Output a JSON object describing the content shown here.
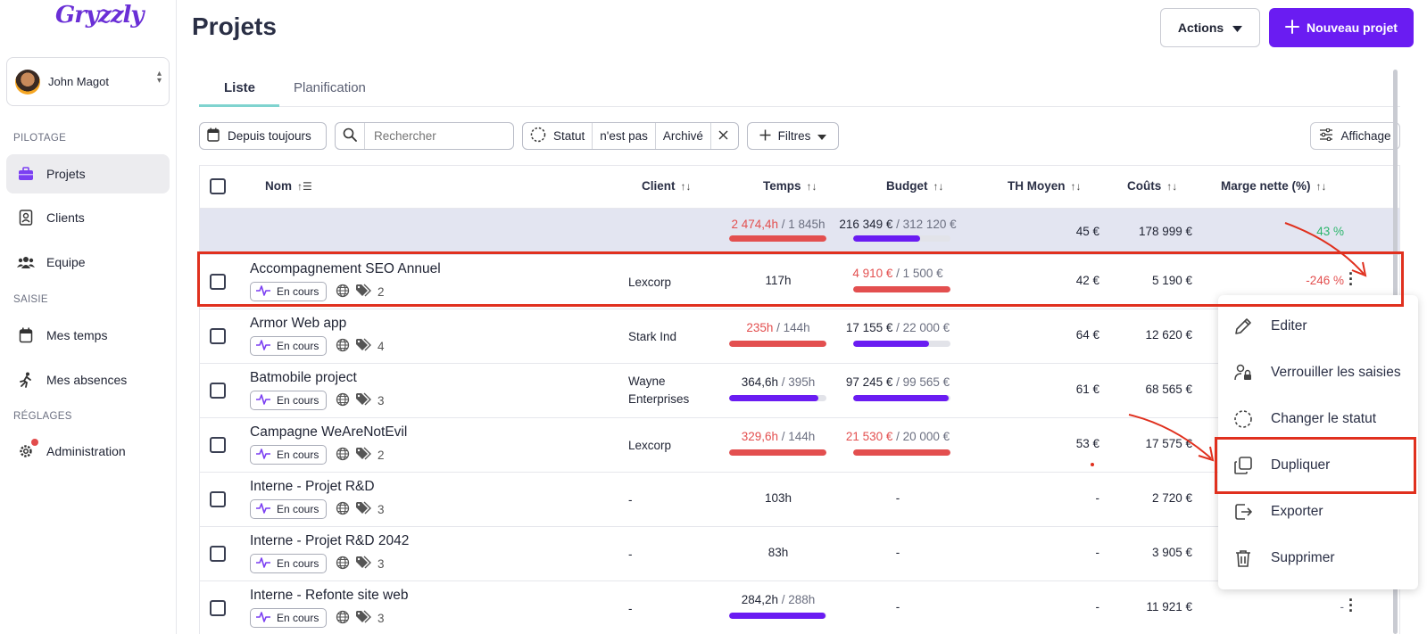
{
  "app": {
    "logo_text": "Gryzzly",
    "accent": "#6a1cf2"
  },
  "sidebar": {
    "user_name": "John Magot",
    "sections": {
      "pilotage": "PILOTAGE",
      "saisie": "SAISIE",
      "reglages": "RÉGLAGES"
    },
    "items": [
      {
        "label": "Projets",
        "icon": "briefcase-icon",
        "active": true
      },
      {
        "label": "Clients",
        "icon": "contact-card-icon"
      },
      {
        "label": "Equipe",
        "icon": "team-icon"
      },
      {
        "label": "Mes temps",
        "icon": "calendar-icon"
      },
      {
        "label": "Mes absences",
        "icon": "running-person-icon"
      },
      {
        "label": "Administration",
        "icon": "gear-icon",
        "notification": true
      }
    ]
  },
  "header": {
    "title": "Projets",
    "actions_label": "Actions",
    "new_label": "Nouveau projet"
  },
  "tabs": [
    {
      "label": "Liste",
      "active": true
    },
    {
      "label": "Planification"
    }
  ],
  "filters": {
    "period": "Depuis toujours",
    "search_placeholder": "Rechercher",
    "status_label": "Statut",
    "status_operator": "n'est pas",
    "status_value": "Archivé",
    "more_filters": "Filtres",
    "display": "Affichage"
  },
  "table": {
    "columns": {
      "name": "Nom",
      "client": "Client",
      "time": "Temps",
      "budget": "Budget",
      "th": "TH Moyen",
      "costs": "Coûts",
      "margin": "Marge nette (%)"
    },
    "summary": {
      "time_used": "2 474,4h",
      "time_total": " / 1 845h",
      "time_fill": 1.0,
      "budget_used": "216 349 €",
      "budget_total": " / 312 120 €",
      "budget_fill": 0.69,
      "th": "45 €",
      "costs": "178 999 €",
      "margin": "43 %"
    },
    "rows": [
      {
        "name": "Accompagnement SEO Annuel",
        "status": "En cours",
        "tags": "2",
        "client": "Lexcorp",
        "client2": "",
        "time_used": "117h",
        "time_total": "",
        "time_over": false,
        "time_fill": null,
        "budget_used": "4 910 €",
        "budget_total": " / 1 500 €",
        "budget_over": true,
        "budget_fill": 1.0,
        "th": "42 €",
        "costs": "5 190 €",
        "margin": "-246 %"
      },
      {
        "name": "Armor Web app",
        "status": "En cours",
        "tags": "4",
        "client": "Stark Ind",
        "client2": "",
        "time_used": "235h",
        "time_total": " / 144h",
        "time_over": true,
        "time_fill": 1.0,
        "budget_used": "17 155 €",
        "budget_total": " / 22 000 €",
        "budget_over": false,
        "budget_fill": 0.78,
        "th": "64 €",
        "costs": "12 620 €",
        "margin": ""
      },
      {
        "name": "Batmobile project",
        "status": "En cours",
        "tags": "3",
        "client": "Wayne",
        "client2": "Enterprises",
        "time_used": "364,6h",
        "time_total": " / 395h",
        "time_over": false,
        "time_fill": 0.92,
        "budget_used": "97 245 €",
        "budget_total": " / 99 565 €",
        "budget_over": false,
        "budget_fill": 0.98,
        "th": "61 €",
        "costs": "68 565 €",
        "margin": ""
      },
      {
        "name": "Campagne WeAreNotEvil",
        "status": "En cours",
        "tags": "2",
        "client": "Lexcorp",
        "client2": "",
        "time_used": "329,6h",
        "time_total": " / 144h",
        "time_over": true,
        "time_fill": 1.0,
        "budget_used": "21 530 €",
        "budget_total": " / 20 000 €",
        "budget_over": true,
        "budget_fill": 1.0,
        "th": "53 €",
        "costs": "17 575 €",
        "margin": ""
      },
      {
        "name": "Interne - Projet R&D",
        "status": "En cours",
        "tags": "3",
        "client": "-",
        "client2": "",
        "time_used": "103h",
        "time_total": "",
        "time_over": false,
        "time_fill": null,
        "budget_used": "-",
        "budget_total": "",
        "budget_over": false,
        "budget_fill": null,
        "th": "-",
        "costs": "2 720 €",
        "margin": ""
      },
      {
        "name": "Interne - Projet R&D 2042",
        "status": "En cours",
        "tags": "3",
        "client": "-",
        "client2": "",
        "time_used": "83h",
        "time_total": "",
        "time_over": false,
        "time_fill": null,
        "budget_used": "-",
        "budget_total": "",
        "budget_over": false,
        "budget_fill": null,
        "th": "-",
        "costs": "3 905 €",
        "margin": ""
      },
      {
        "name": "Interne - Refonte site web",
        "status": "En cours",
        "tags": "3",
        "client": "-",
        "client2": "",
        "time_used": "284,2h",
        "time_total": " / 288h",
        "time_over": false,
        "time_fill": 0.99,
        "budget_used": "-",
        "budget_total": "",
        "budget_over": false,
        "budget_fill": null,
        "th": "-",
        "costs": "11 921 €",
        "margin": "-"
      }
    ]
  },
  "menu": {
    "items": [
      {
        "label": "Editer",
        "icon": "pencil-icon"
      },
      {
        "label": "Verrouiller les saisies",
        "icon": "user-lock-icon"
      },
      {
        "label": "Changer le statut",
        "icon": "dashed-circle-icon"
      },
      {
        "label": "Dupliquer",
        "icon": "duplicate-icon"
      },
      {
        "label": "Exporter",
        "icon": "export-icon"
      },
      {
        "label": "Supprimer",
        "icon": "trash-icon"
      }
    ]
  },
  "colors": {
    "highlight": "#e0301e",
    "over_budget": "#e34f4f",
    "positive": "#2bb56b"
  }
}
